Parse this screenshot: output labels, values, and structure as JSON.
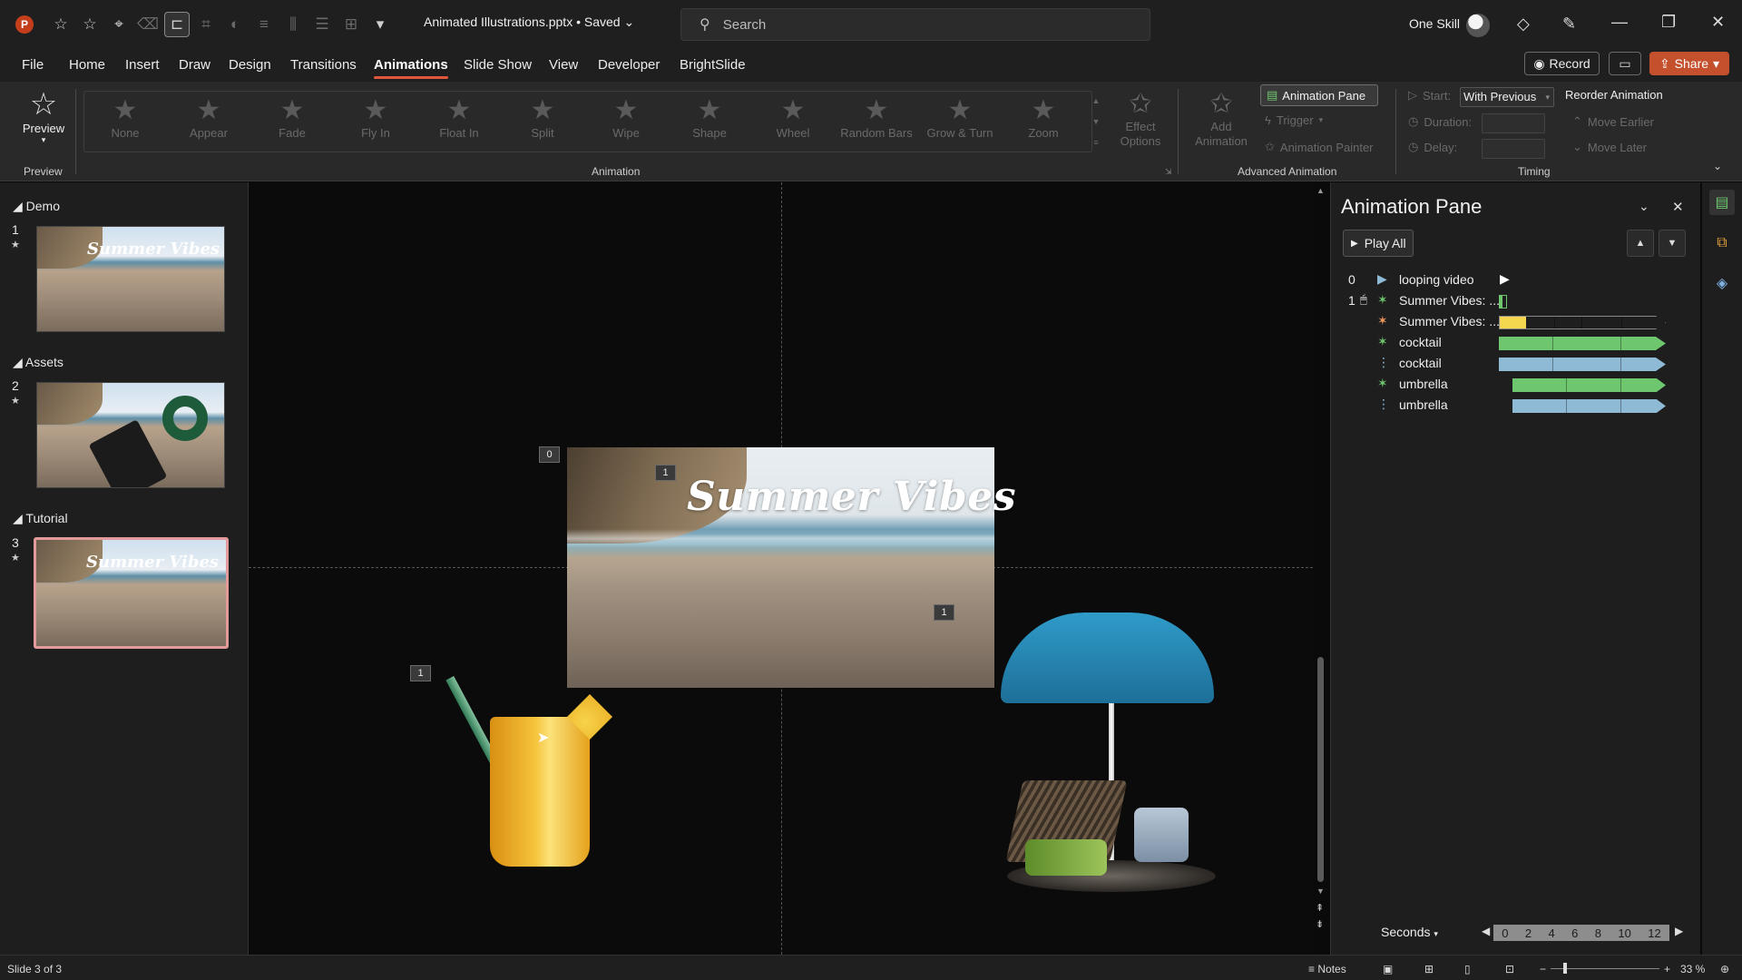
{
  "titlebar": {
    "doc_title": "Animated Illustrations.pptx • Saved ⌄",
    "search_placeholder": "Search",
    "account_name": "One Skill"
  },
  "menu": {
    "tabs": [
      "File",
      "Home",
      "Insert",
      "Draw",
      "Design",
      "Transitions",
      "Animations",
      "Slide Show",
      "View",
      "Developer",
      "BrightSlide"
    ],
    "selected": "Animations",
    "record": "Record",
    "share": "Share"
  },
  "ribbon": {
    "preview_label": "Preview",
    "preview_group": "Preview",
    "animation_group": "Animation",
    "animations": [
      "None",
      "Appear",
      "Fade",
      "Fly In",
      "Float In",
      "Split",
      "Wipe",
      "Shape",
      "Wheel",
      "Random Bars",
      "Grow & Turn",
      "Zoom"
    ],
    "effect_options": "Effect\nOptions",
    "add_animation": "Add\nAnimation",
    "advanced_group": "Advanced Animation",
    "animation_pane_btn": "Animation Pane",
    "trigger": "Trigger",
    "animation_painter": "Animation Painter",
    "timing_group": "Timing",
    "start_label": "Start:",
    "start_value": "With Previous",
    "duration_label": "Duration:",
    "delay_label": "Delay:",
    "reorder_label": "Reorder Animation",
    "move_earlier": "Move Earlier",
    "move_later": "Move Later"
  },
  "thumbnails": {
    "sections": [
      {
        "name": "Demo",
        "slide": "1",
        "title": "Summer Vibes"
      },
      {
        "name": "Assets",
        "slide": "2",
        "title": ""
      },
      {
        "name": "Tutorial",
        "slide": "3",
        "title": "Summer Vibes"
      }
    ]
  },
  "slide": {
    "title": "Summer Vibes",
    "tags": [
      "0",
      "1",
      "1",
      "1"
    ]
  },
  "animation_pane": {
    "title": "Animation Pane",
    "play_all": "Play All",
    "items": [
      {
        "num": "0",
        "name": "looping video",
        "kind": "play"
      },
      {
        "num": "1",
        "name": "Summer Vibes: ...",
        "kind": "entrance"
      },
      {
        "num": "",
        "name": "Summer Vibes: ...",
        "kind": "emphasis"
      },
      {
        "num": "",
        "name": "cocktail",
        "kind": "entrance"
      },
      {
        "num": "",
        "name": "cocktail",
        "kind": "motion"
      },
      {
        "num": "",
        "name": "umbrella",
        "kind": "entrance"
      },
      {
        "num": "",
        "name": "umbrella",
        "kind": "motion"
      }
    ],
    "seconds_label": "Seconds",
    "timeline_ticks": [
      "0",
      "2",
      "4",
      "6",
      "8",
      "10",
      "12"
    ]
  },
  "statusbar": {
    "slide_info": "Slide 3 of 3",
    "notes": "Notes",
    "zoom": "33 %"
  },
  "colors": {
    "accent": "#e0573c",
    "share": "#c4502e",
    "entrance_bar": "#6ec76e",
    "motion_bar": "#8fbad6",
    "emphasis_bar": "#f5d64f"
  }
}
